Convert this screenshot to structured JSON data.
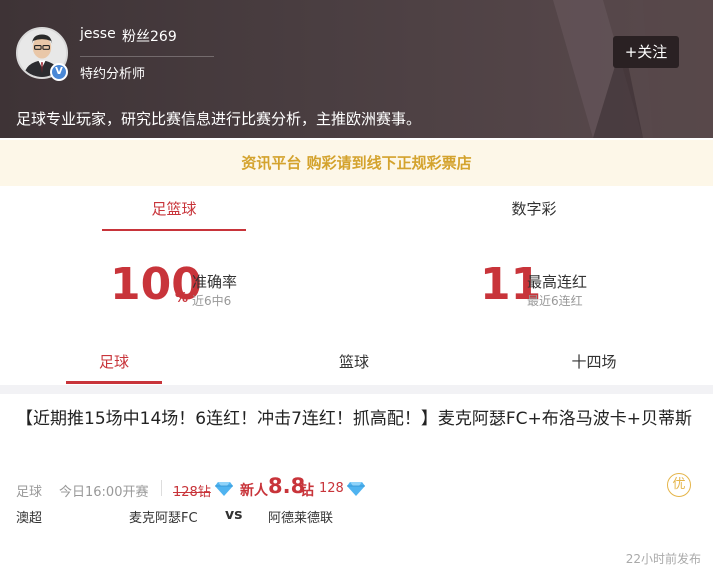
{
  "expert": {
    "username": "jesse",
    "fans": "粉丝269",
    "role": "特约分析师",
    "follow_label": "+关注",
    "bio": "足球专业玩家，研究比赛信息进行比赛分析，主推欧洲赛事。",
    "verified_badge": "V"
  },
  "notice": "资讯平台 购彩请到线下正规彩票店",
  "category_tabs": [
    {
      "label": "足篮球",
      "active": true
    },
    {
      "label": "数字彩",
      "active": false
    }
  ],
  "stats": {
    "accuracy": {
      "value": "100",
      "unit": "%",
      "label": "准确率",
      "sub": "近6中6"
    },
    "streak": {
      "value": "11",
      "label": "最高连红",
      "sub": "最近6连红"
    }
  },
  "sport_tabs": [
    {
      "label": "足球",
      "active": true
    },
    {
      "label": "篮球",
      "active": false
    },
    {
      "label": "十四场",
      "active": false
    }
  ],
  "article": {
    "title": "【近期推15场中14场！6连红！冲击7连红！抓高配！】麦克阿瑟FC+布洛马波卡+贝蒂斯",
    "sport": "足球",
    "kickoff": "今日16:00开赛",
    "old_price": "128钻",
    "newbie_label": "新人",
    "new_price": "8.8",
    "zuan_unit": "钻",
    "regular_price": "128",
    "badge": "优",
    "league": "澳超",
    "home": "麦克阿瑟FC",
    "vs": "vs",
    "away": "阿德莱德联",
    "published": "22小时前发布"
  },
  "colors": {
    "accent": "#c8343a",
    "notice_text": "#d4a32e",
    "header_bg": "#3e3336",
    "diamond": "#4fb3f0"
  }
}
